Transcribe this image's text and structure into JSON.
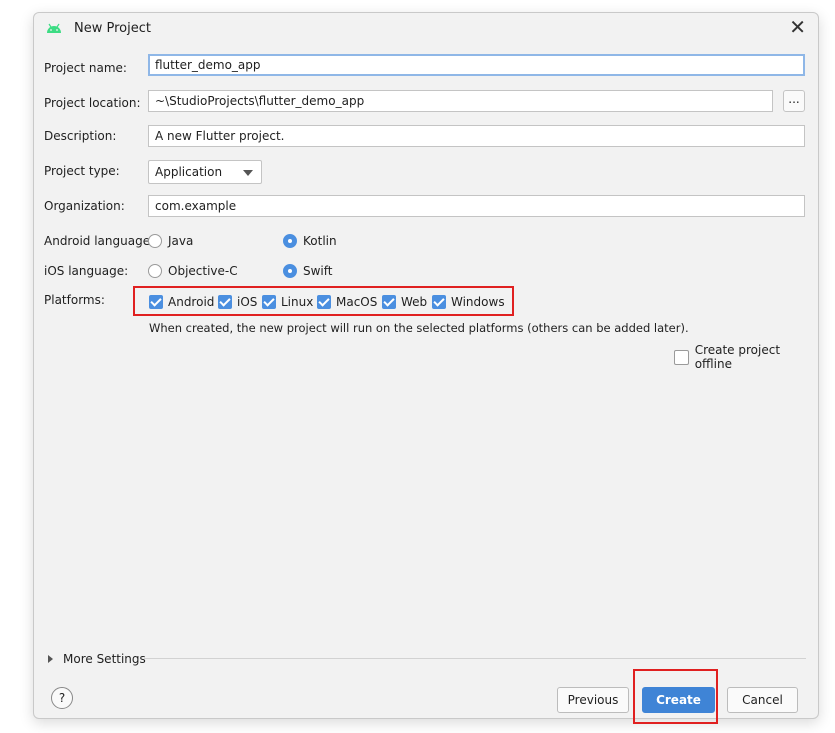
{
  "dialog": {
    "title": "New Project",
    "close_label": "✕"
  },
  "form": {
    "project_name_label": "Project name:",
    "project_name_value": "flutter_demo_app",
    "project_location_label": "Project location:",
    "project_location_value": "~\\StudioProjects\\flutter_demo_app",
    "browse_label": "...",
    "description_label": "Description:",
    "description_value": "A new Flutter project.",
    "project_type_label": "Project type:",
    "project_type_value": "Application",
    "organization_label": "Organization:",
    "organization_value": "com.example",
    "android_language_label": "Android language:",
    "android_options": [
      {
        "label": "Java",
        "selected": false
      },
      {
        "label": "Kotlin",
        "selected": true
      }
    ],
    "ios_language_label": "iOS language:",
    "ios_options": [
      {
        "label": "Objective-C",
        "selected": false
      },
      {
        "label": "Swift",
        "selected": true
      }
    ],
    "platforms_label": "Platforms:",
    "platforms": [
      {
        "label": "Android",
        "checked": true
      },
      {
        "label": "iOS",
        "checked": true
      },
      {
        "label": "Linux",
        "checked": true
      },
      {
        "label": "MacOS",
        "checked": true
      },
      {
        "label": "Web",
        "checked": true
      },
      {
        "label": "Windows",
        "checked": true
      }
    ],
    "platforms_hint": "When created, the new project will run on the selected platforms (others can be added later).",
    "offline_label": "Create project offline",
    "offline_checked": false
  },
  "more_settings_label": "More Settings",
  "footer": {
    "help_label": "?",
    "previous_label": "Previous",
    "create_label": "Create",
    "cancel_label": "Cancel"
  },
  "colors": {
    "accent": "#4b8fe0",
    "highlight": "#e02020",
    "android_green": "#3ddc84"
  }
}
